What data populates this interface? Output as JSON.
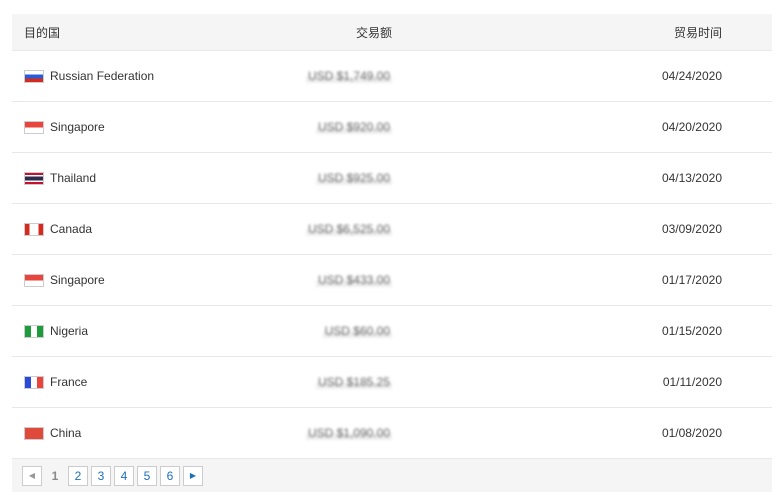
{
  "headers": {
    "country": "目的国",
    "amount": "交易额",
    "date": "贸易时间"
  },
  "rows": [
    {
      "country": "Russian Federation",
      "flag": "russia",
      "amount": "USD $1,749.00",
      "date": "04/24/2020"
    },
    {
      "country": "Singapore",
      "flag": "singapore",
      "amount": "USD $920.00",
      "date": "04/20/2020"
    },
    {
      "country": "Thailand",
      "flag": "thailand",
      "amount": "USD $925.00",
      "date": "04/13/2020"
    },
    {
      "country": "Canada",
      "flag": "canada",
      "amount": "USD $6,525.00",
      "date": "03/09/2020"
    },
    {
      "country": "Singapore",
      "flag": "singapore",
      "amount": "USD $433.00",
      "date": "01/17/2020"
    },
    {
      "country": "Nigeria",
      "flag": "nigeria",
      "amount": "USD $60.00",
      "date": "01/15/2020"
    },
    {
      "country": "France",
      "flag": "france",
      "amount": "USD $185.25",
      "date": "01/11/2020"
    },
    {
      "country": "China",
      "flag": "china",
      "amount": "USD $1,090.00",
      "date": "01/08/2020"
    }
  ],
  "pagination": {
    "current": "1",
    "pages": [
      "2",
      "3",
      "4",
      "5",
      "6"
    ]
  }
}
